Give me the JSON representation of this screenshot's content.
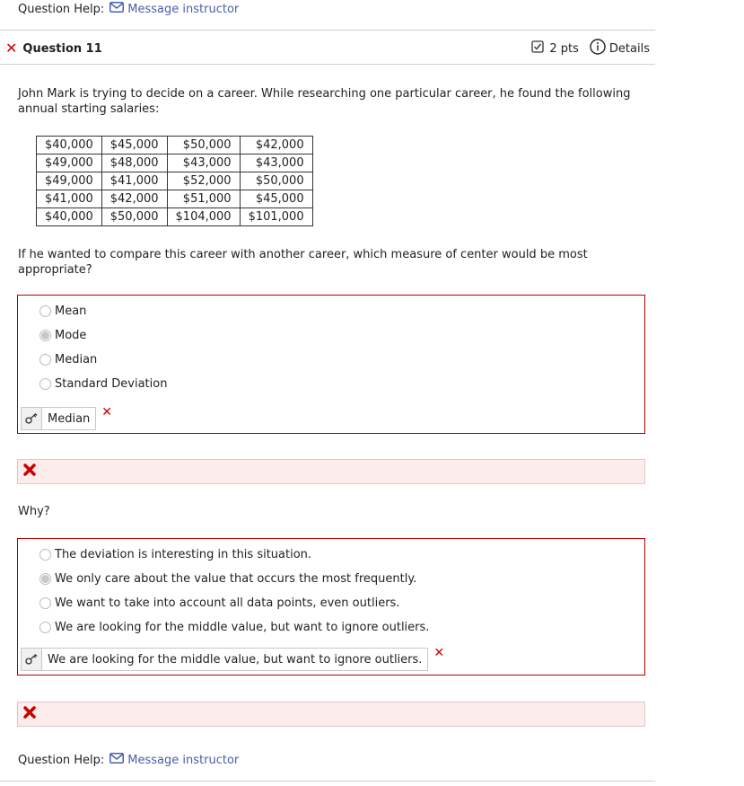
{
  "top_help": {
    "label": "Question Help:",
    "link": "Message instructor"
  },
  "question": {
    "title": "Question 11",
    "points": "2 pts",
    "details": "Details"
  },
  "prompt": "John Mark is trying to decide on a career. While researching one particular career, he found the following annual starting salaries:",
  "salaries": [
    [
      "$40,000",
      "$45,000",
      "$50,000",
      "$42,000"
    ],
    [
      "$49,000",
      "$48,000",
      "$43,000",
      "$43,000"
    ],
    [
      "$49,000",
      "$41,000",
      "$52,000",
      "$50,000"
    ],
    [
      "$41,000",
      "$42,000",
      "$51,000",
      "$45,000"
    ],
    [
      "$40,000",
      "$50,000",
      "$104,000",
      "$101,000"
    ]
  ],
  "part1": {
    "question": "If he wanted to compare this career with another career, which measure of center would be most appropriate?",
    "options": [
      "Mean",
      "Mode",
      "Median",
      "Standard Deviation"
    ],
    "selected_index": 1,
    "correct_answer": "Median"
  },
  "why_label": "Why?",
  "part2": {
    "options": [
      "The deviation is interesting in this situation.",
      "We only care about the value that occurs the most frequently.",
      "We want to take into account all data points, even outliers.",
      "We are looking for the middle value, but want to ignore outliers."
    ],
    "selected_index": 1,
    "correct_answer": "We are looking for the middle value, but want to ignore outliers."
  },
  "bottom_help": {
    "label": "Question Help:",
    "link": "Message instructor"
  },
  "colors": {
    "link": "#4a5fa8",
    "error": "#cc0000",
    "feedback_bg": "#fdecec",
    "answer_border": "#b40000"
  },
  "icons": {
    "message": "envelope-icon",
    "wrong": "x-mark-icon",
    "points": "checkbox-icon",
    "details": "info-icon",
    "key": "key-icon"
  }
}
